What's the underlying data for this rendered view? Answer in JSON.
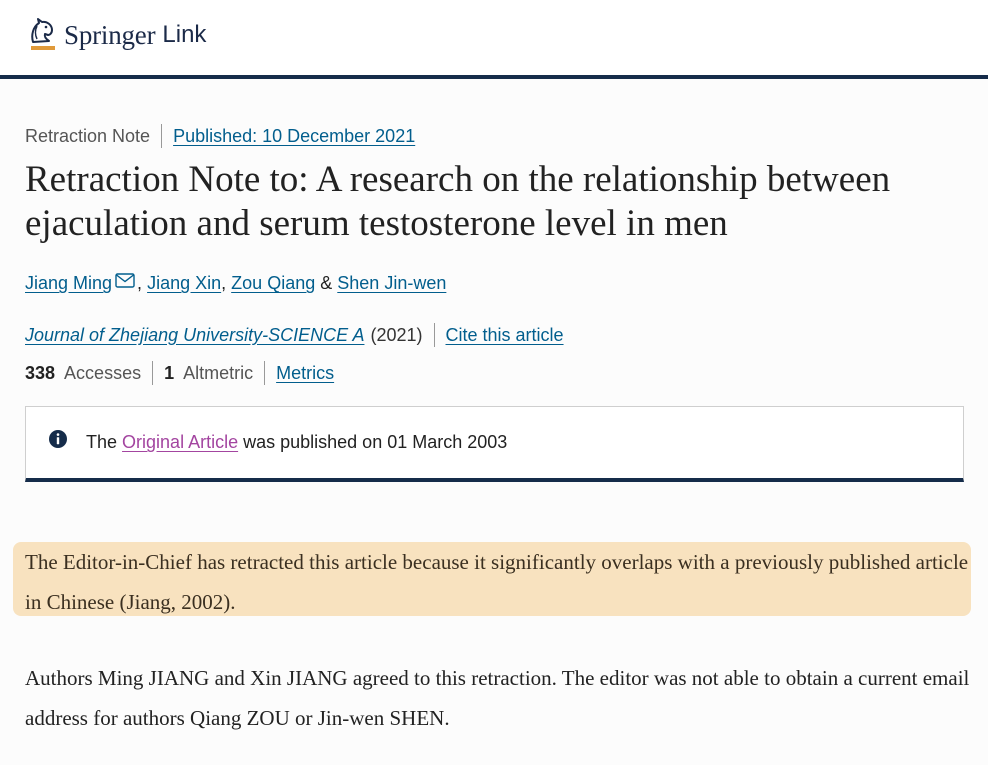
{
  "header": {
    "brand": "Springer",
    "brand_suffix": "Link"
  },
  "meta": {
    "article_type": "Retraction Note",
    "published": "Published: 10 December 2021"
  },
  "title": "Retraction Note to: A research on the relationship between ejaculation and serum testosterone level in men",
  "authors": {
    "list": [
      "Jiang Ming",
      "Jiang Xin",
      "Zou Qiang",
      "Shen Jin-wen"
    ],
    "comma": ",",
    "ampersand": "&"
  },
  "journal": {
    "name": "Journal of Zhejiang University-SCIENCE A",
    "year": "(2021)",
    "cite": "Cite this article"
  },
  "metrics": {
    "accesses_count": "338",
    "accesses_label": "Accesses",
    "altmetric_count": "1",
    "altmetric_label": "Altmetric",
    "metrics_link": "Metrics"
  },
  "notice": {
    "prefix": "The",
    "link": "Original Article",
    "suffix": "was published on 01 March 2003"
  },
  "body": {
    "paragraph1": "The Editor-in-Chief has retracted this article because it significantly overlaps with a previously published article in Chinese (Jiang, 2002).",
    "paragraph2": "Authors Ming JIANG and Xin JIANG agreed to this retraction. The editor was not able to obtain a current email address for authors Qiang ZOU or Jin-wen SHEN."
  },
  "colors": {
    "navy": "#152c4a",
    "link": "#025e8d",
    "visited_link": "#a345a0",
    "highlight": "#f8e2bf",
    "logo_accent": "#e09a3a"
  },
  "icons": [
    "springer-horse-logo",
    "mail-icon",
    "info-icon"
  ]
}
